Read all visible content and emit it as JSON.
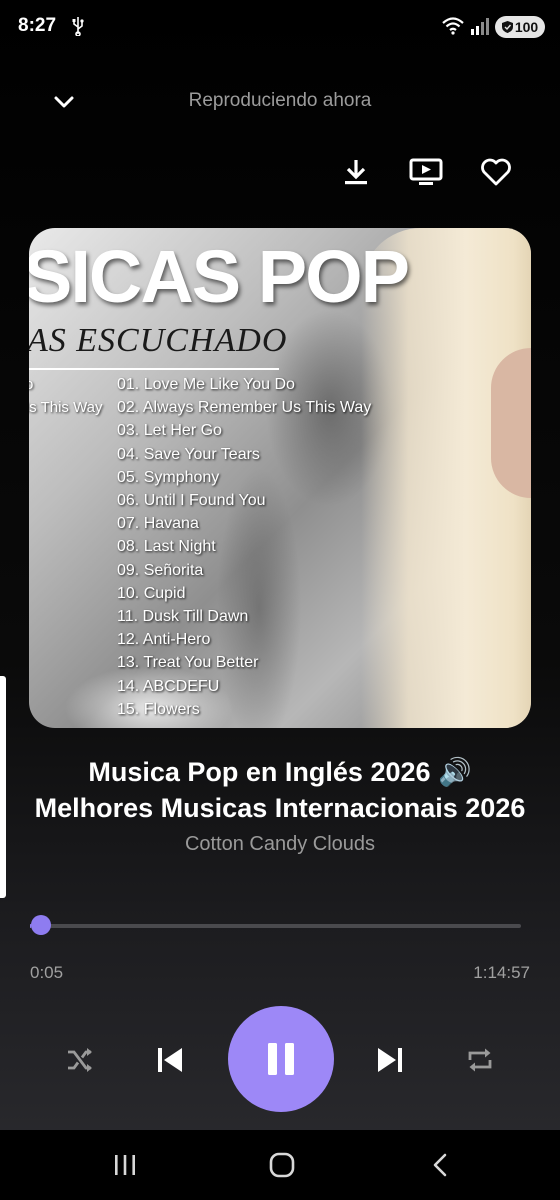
{
  "status_bar": {
    "time": "8:27",
    "battery": "100",
    "icons": [
      "usb-icon",
      "wifi-icon",
      "signal-icon",
      "battery-shield-icon"
    ]
  },
  "header": {
    "title": "Reproduciendo ahora",
    "icons": [
      "chevron-down-icon",
      "download-icon",
      "cast-video-icon",
      "heart-icon"
    ]
  },
  "artwork": {
    "title_text": "SICAS POP",
    "subtitle_text": "AS ESCUCHADO",
    "left_column": [
      "o",
      "Is This Way"
    ],
    "tracklist": [
      "01. Love Me Like You Do",
      "02. Always Remember Us This Way",
      "03. Let Her Go",
      "04. Save Your Tears",
      "05. Symphony",
      "06. Until I Found You",
      "07. Havana",
      "08. Last Night",
      "09. Señorita",
      "10. Cupid",
      "11. Dusk Till Dawn",
      "12. Anti-Hero",
      "13. Treat You Better",
      "14. ABCDEFU",
      "15. Flowers"
    ]
  },
  "track": {
    "title_line1": "Musica Pop en Inglés 2026 🔊",
    "title_line2": "Melhores Musicas Internacionais 2026",
    "artist": "Cotton Candy Clouds"
  },
  "playback": {
    "elapsed": "0:05",
    "total": "1:14:57",
    "progress": 0.0011,
    "accent_color": "#9d88f7",
    "state": "playing"
  },
  "controls": {
    "icons": [
      "shuffle-icon",
      "previous-icon",
      "pause-icon",
      "next-icon",
      "repeat-icon"
    ]
  },
  "nav_bar": {
    "icons": [
      "recent-apps-icon",
      "home-icon",
      "back-icon"
    ]
  }
}
